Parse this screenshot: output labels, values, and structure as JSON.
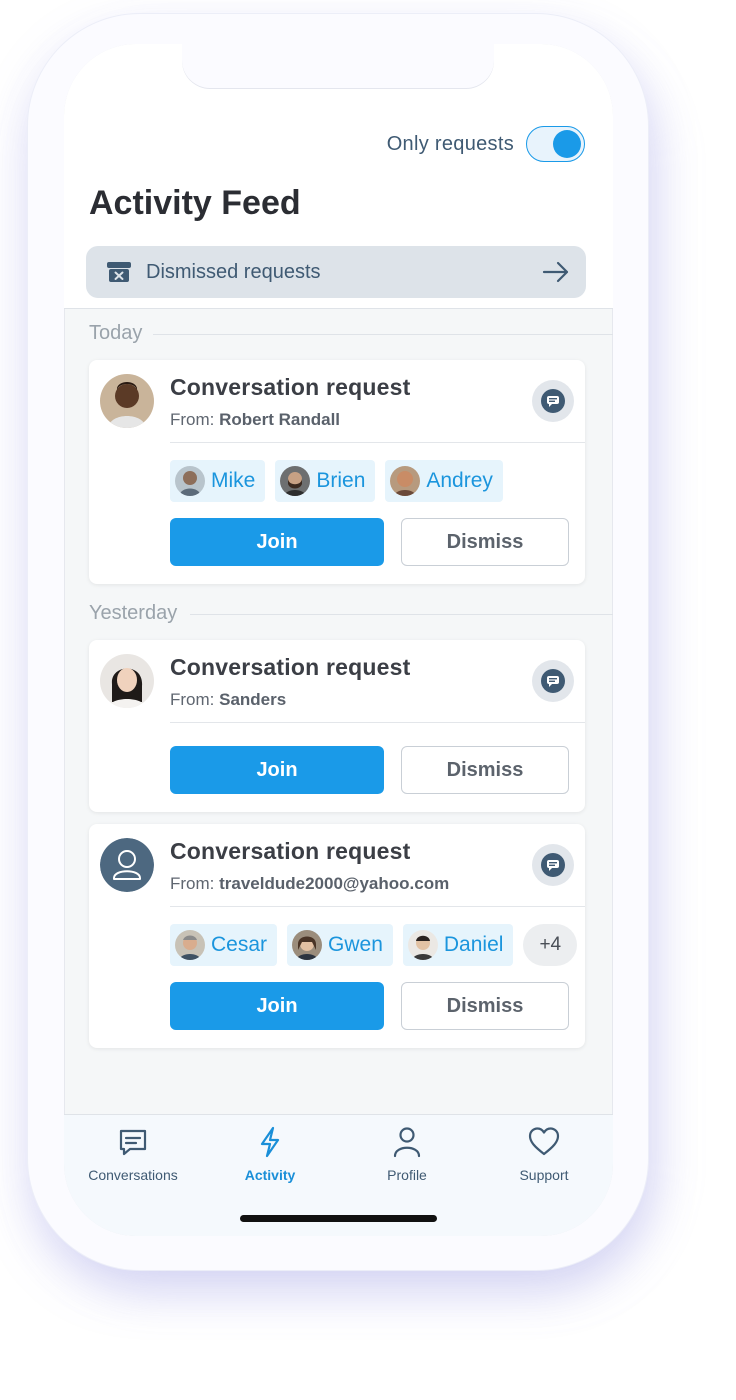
{
  "header": {
    "toggle_label": "Only requests",
    "toggle_on": true,
    "title": "Activity Feed",
    "dismissed_label": "Dismissed requests"
  },
  "sections": [
    {
      "label": "Today"
    },
    {
      "label": "Yesterday"
    }
  ],
  "cards": [
    {
      "title": "Conversation request",
      "from_prefix": "From: ",
      "from_name": "Robert Randall",
      "participants": [
        "Mike",
        "Brien",
        "Andrey"
      ],
      "join_label": "Join",
      "dismiss_label": "Dismiss"
    },
    {
      "title": "Conversation request",
      "from_prefix": "From: ",
      "from_name": "Sanders",
      "participants": [],
      "join_label": "Join",
      "dismiss_label": "Dismiss"
    },
    {
      "title": "Conversation request",
      "from_prefix": "From: ",
      "from_name": "traveldude2000@yahoo.com",
      "participants": [
        "Cesar",
        "Gwen",
        "Daniel"
      ],
      "more_label": "+4",
      "join_label": "Join",
      "dismiss_label": "Dismiss"
    }
  ],
  "tabbar": {
    "tabs": [
      {
        "label": "Conversations",
        "icon": "chat-icon"
      },
      {
        "label": "Activity",
        "icon": "lightning-icon",
        "active": true
      },
      {
        "label": "Profile",
        "icon": "person-icon"
      },
      {
        "label": "Support",
        "icon": "heart-icon"
      }
    ]
  },
  "colors": {
    "accent": "#1a9ae8",
    "title": "#2b2d33",
    "muted": "#9aa3ab"
  }
}
